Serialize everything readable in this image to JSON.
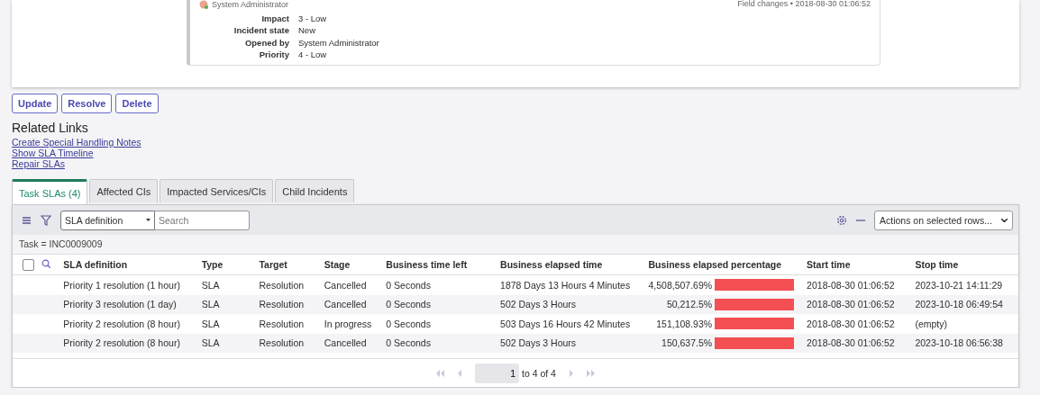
{
  "activity": {
    "author": "System Administrator",
    "meta": "Field changes • 2018-08-30 01:06:52",
    "fields": [
      {
        "label": "Impact",
        "value": "3 - Low"
      },
      {
        "label": "Incident state",
        "value": "New"
      },
      {
        "label": "Opened by",
        "value": "System Administrator"
      },
      {
        "label": "Priority",
        "value": "4 - Low"
      }
    ]
  },
  "buttons": [
    "Update",
    "Resolve",
    "Delete"
  ],
  "related_links": {
    "title": "Related Links",
    "links": [
      "Create Special Handling Notes",
      "Show SLA Timeline",
      "Repair SLAs"
    ]
  },
  "tabs": [
    {
      "label": "Task SLAs (4)",
      "selected": true
    },
    {
      "label": "Affected CIs",
      "selected": false
    },
    {
      "label": "Impacted Services/CIs",
      "selected": false
    },
    {
      "label": "Child Incidents",
      "selected": false
    }
  ],
  "list": {
    "select_all": {
      "checked": false
    },
    "search_field": "SLA definition",
    "search": {
      "placeholder": "Search"
    },
    "actions": "Actions on selected rows...",
    "filter": "Task = INC0009009",
    "columns": [
      "SLA definition",
      "Type",
      "Target",
      "Stage",
      "Business time left",
      "Business elapsed time",
      "Business elapsed percentage",
      "Start time",
      "Stop time"
    ],
    "rows": [
      {
        "cells": [
          "Priority 1 resolution (1 hour)",
          "SLA",
          "Resolution",
          "Cancelled",
          "0 Seconds",
          "1878 Days 13 Hours 4 Minutes",
          "4,508,507.69%",
          "2018-08-30 01:06:52",
          "2023-10-21 14:11:29"
        ],
        "level": 1
      },
      {
        "cells": [
          "Priority 3 resolution (1 day)",
          "SLA",
          "Resolution",
          "Cancelled",
          "0 Seconds",
          "502 Days 3 Hours",
          "50,212.5%",
          "2018-08-30 01:06:52",
          "2023-10-18 06:49:54"
        ],
        "level": 1
      },
      {
        "cells": [
          "Priority 2 resolution (8 hour)",
          "SLA",
          "Resolution",
          "In progress",
          "0 Seconds",
          "503 Days 16 Hours 42 Minutes",
          "151,108.93%",
          "2018-08-30 01:06:52",
          "(empty)"
        ],
        "level": 1
      },
      {
        "cells": [
          "Priority 2 resolution (8 hour)",
          "SLA",
          "Resolution",
          "Cancelled",
          "0 Seconds",
          "502 Days 3 Hours",
          "150,637.5%",
          "2018-08-30 01:06:52",
          "2023-10-18 06:56:38"
        ],
        "level": 1
      }
    ],
    "pagination": {
      "page": "1",
      "range": "to 4 of 4"
    }
  }
}
